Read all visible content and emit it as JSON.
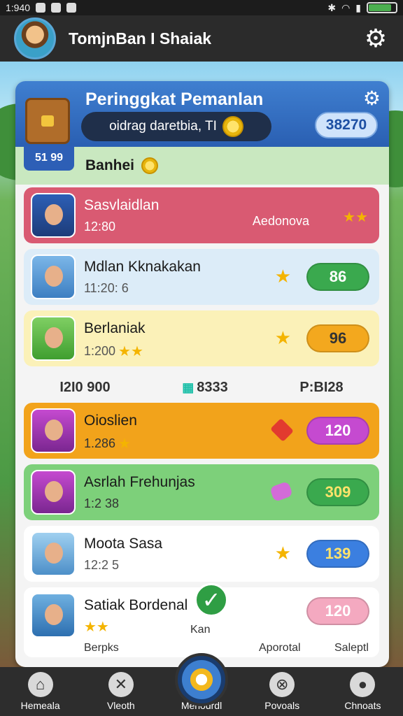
{
  "status_bar": {
    "time": "1:940",
    "battery_pct": 0.85
  },
  "header": {
    "title": "TomjnBan I Shaiak"
  },
  "panel": {
    "title": "Peringgkat Pemanlan",
    "search_text": "oidrag daretbia, TI",
    "score": "38270",
    "badge": "51 99",
    "section_label": "Banhei"
  },
  "players": [
    {
      "name": "Sasvlaidlan",
      "meta": "12:80",
      "right_label": "Aedonova",
      "points": "",
      "bg": "#d95a72",
      "text_light": true
    },
    {
      "name": "Mdlan Kknakakan",
      "meta": "11:20: 6",
      "points": "86",
      "points_color": "#3aa94e",
      "bg": "#dcecf8"
    },
    {
      "name": "Berlaniak",
      "meta": "1:200",
      "points": "96",
      "points_color": "#f3a81e",
      "bg": "#fbf1b8"
    },
    {
      "name": "Oioslien",
      "meta": "1.286",
      "points": "120",
      "points_color": "#c54ad0",
      "bg": "#f2a31b"
    },
    {
      "name": "Asrlah Frehunjas",
      "meta": "1:2 38",
      "points": "309",
      "points_color": "#3aa94e",
      "bg": "#7dd07a"
    },
    {
      "name": "Moota Sasa",
      "meta": "12:2 5",
      "points": "139",
      "points_color": "#3b7fe0",
      "bg": "#ffffff"
    },
    {
      "name": "Satiak Bordenal",
      "meta": "",
      "points": "120",
      "points_color": "#f4a9c0",
      "bg": "#ffffff"
    }
  ],
  "summary": {
    "left": "I2I0 900",
    "mid": "8333",
    "right": "P:BI28"
  },
  "extras": {
    "kan": "Kan",
    "berpks": "Berpks",
    "aporotal": "Aporotal",
    "salepitl": "Saleptl"
  },
  "nav": [
    {
      "label": "Hemeala",
      "icon": "home-icon"
    },
    {
      "label": "Vleoth",
      "icon": "tools-icon"
    },
    {
      "label": "Menodrdl",
      "icon": "target-icon"
    },
    {
      "label": "Povoals",
      "icon": "crossed-icon"
    },
    {
      "label": "Chnoats",
      "icon": "user-icon"
    }
  ]
}
